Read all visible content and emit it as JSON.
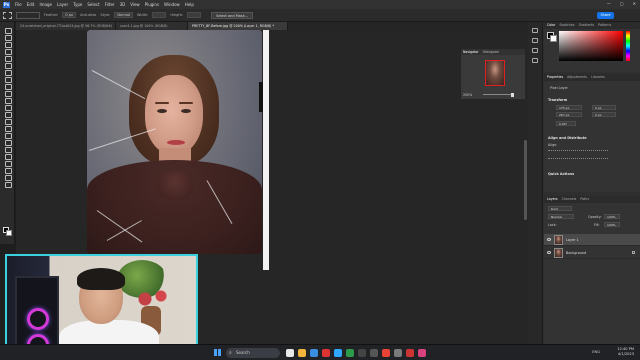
{
  "app": {
    "logo": "Ps",
    "menu": [
      "File",
      "Edit",
      "Image",
      "Layer",
      "Type",
      "Select",
      "Filter",
      "3D",
      "View",
      "Plugins",
      "Window",
      "Help"
    ],
    "window_controls": [
      "—",
      "▢",
      "✕"
    ]
  },
  "options_bar": {
    "feather_label": "Feather:",
    "feather_value": "0 px",
    "anti_alias_label": "Anti-alias",
    "style_label": "Style:",
    "style_value": "Normal",
    "width_label": "Width:",
    "height_label": "Height:",
    "select_mask_label": "Select and Mask...",
    "share_label": "Share"
  },
  "tabs": [
    {
      "label": "24-scratched_original-731a4d24.jpg @ 56.7% (RGB/8#)",
      "active": false
    },
    {
      "label": "user4-1.jpg @ 100% (RGB/8)",
      "active": false
    },
    {
      "label": "PRETTY_BF-Before.jpg @ 200% (Layer 1, RGB/8) *",
      "active": true
    }
  ],
  "navigator": {
    "tabs": [
      "Navigator",
      "Histogram"
    ],
    "zoom": "200%"
  },
  "color_panel": {
    "tabs": [
      "Color",
      "Swatches",
      "Gradients",
      "Patterns"
    ]
  },
  "properties_panel": {
    "tabs": [
      "Properties",
      "Adjustments",
      "Libraries"
    ],
    "kind": "Pixel Layer",
    "transform_label": "Transform",
    "w_value": "175 px",
    "h_value": "267 px",
    "x_value": "0 px",
    "y_value": "0 px",
    "angle_value": "0.00°",
    "align_label": "Align and Distribute",
    "align_sub": "Align:",
    "quick_actions_label": "Quick Actions"
  },
  "layers_panel": {
    "tabs": [
      "Layers",
      "Channels",
      "Paths"
    ],
    "kind_filter": "Kind",
    "blend_mode": "Normal",
    "opacity_label": "Opacity:",
    "opacity_value": "100%",
    "lock_label": "Lock:",
    "fill_label": "Fill:",
    "fill_value": "100%",
    "layers": [
      {
        "name": "Layer 1",
        "selected": true,
        "locked": false
      },
      {
        "name": "Background",
        "selected": false,
        "locked": true
      }
    ]
  },
  "taskbar": {
    "search_placeholder": "Search",
    "tray_lang": "ENG",
    "time": "12:40 PM",
    "date": "4/1/2023"
  },
  "colors": {
    "accent": "#1473e6",
    "webcam_border": "#3ad0e0"
  }
}
